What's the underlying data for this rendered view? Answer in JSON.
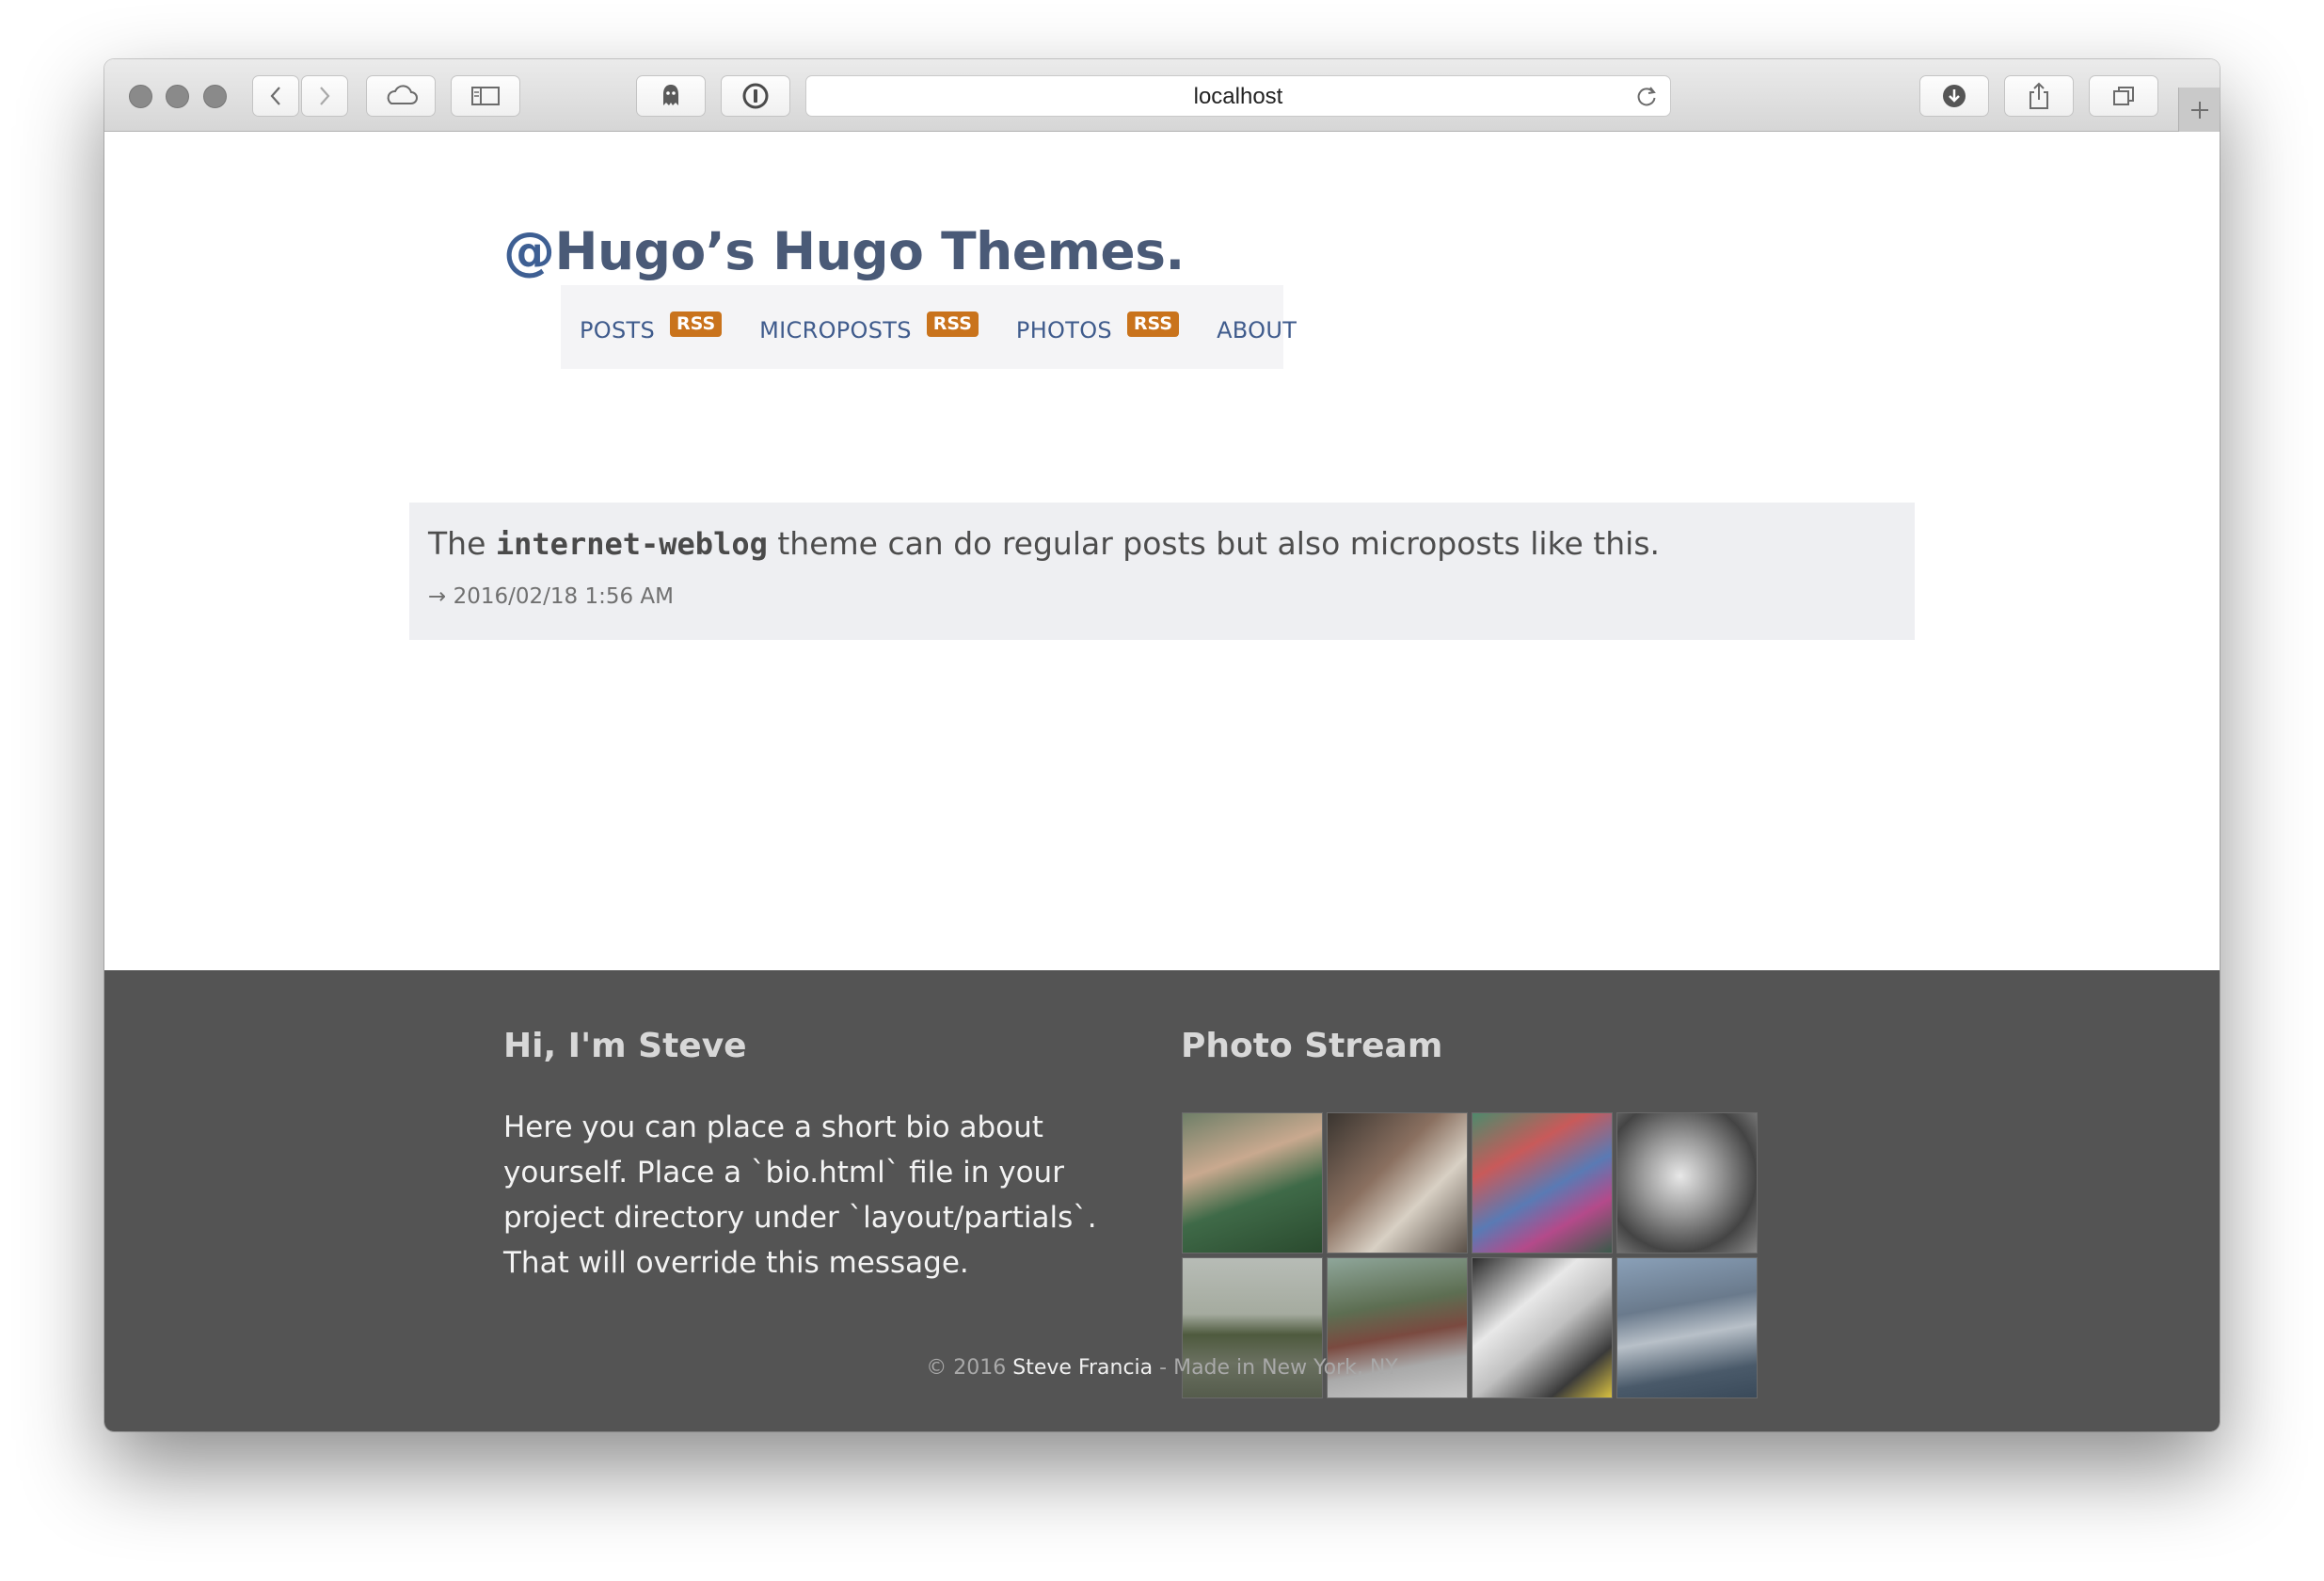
{
  "browser": {
    "url": "localhost"
  },
  "site": {
    "title_at": "@",
    "title_rest": "Hugo’s Hugo Themes."
  },
  "nav": {
    "items": [
      {
        "label": "POSTS",
        "rss": "RSS"
      },
      {
        "label": "MICROPOSTS",
        "rss": "RSS"
      },
      {
        "label": "PHOTOS",
        "rss": "RSS"
      },
      {
        "label": "ABOUT"
      }
    ]
  },
  "post": {
    "text_before": "The ",
    "code": "internet-weblog",
    "text_after": " theme can do regular posts but also microposts like this.",
    "date": "→ 2016/02/18 1:56 AM"
  },
  "footer": {
    "bio_title": "Hi, I'm Steve",
    "bio_text": "Here you can place a short bio about yourself. Place a `bio.html` file in your project directory under `layout/partials`. That will override this message.",
    "photo_title": "Photo Stream",
    "copyright_prefix": "© 2016 ",
    "author": "Steve Francia",
    "copyright_suffix": " - Made in New York, NY"
  },
  "colors": {
    "accent": "#3f5b8c",
    "rss_badge": "#c9731c",
    "footer_bg": "#545454"
  }
}
